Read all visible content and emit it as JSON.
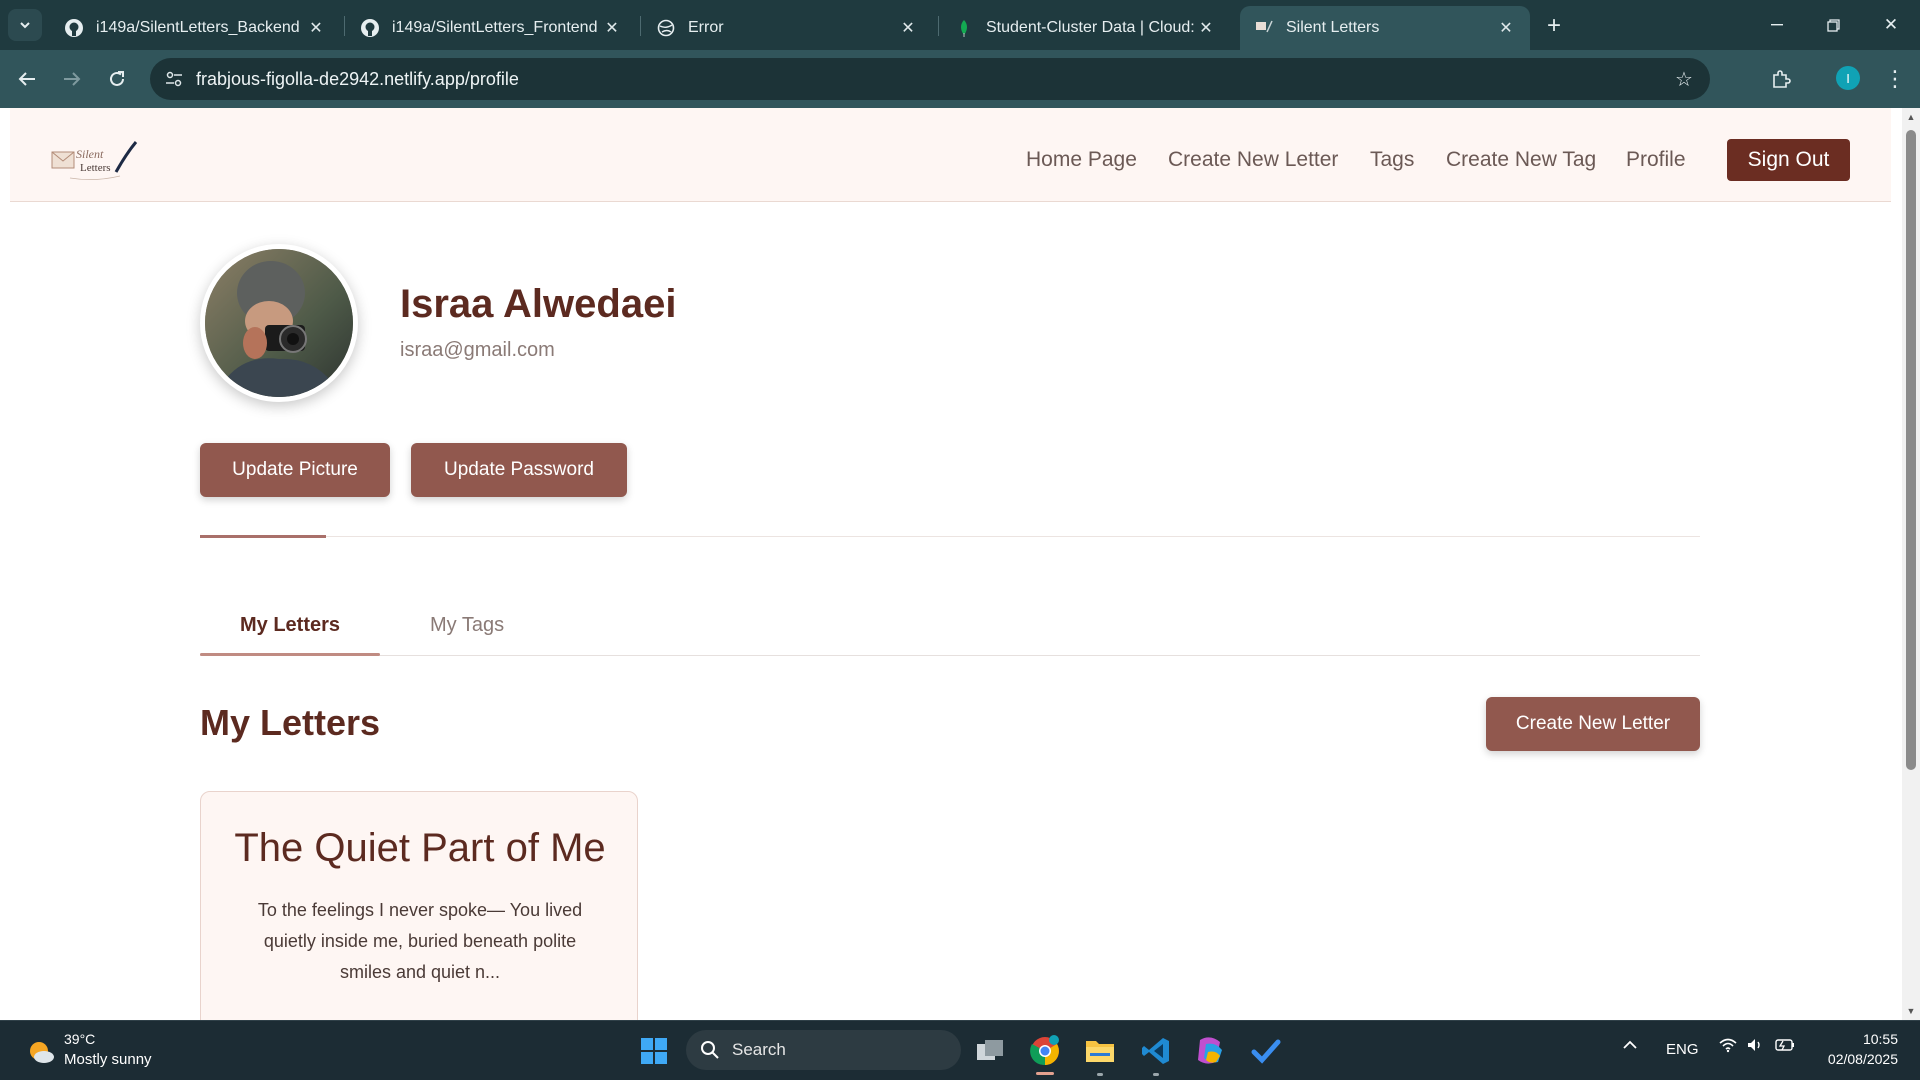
{
  "browser": {
    "tabs": [
      {
        "title": "i149a/SilentLetters_Backend",
        "icon": "github-icon"
      },
      {
        "title": "i149a/SilentLetters_Frontend",
        "icon": "github-icon"
      },
      {
        "title": "Error",
        "icon": "globe-icon"
      },
      {
        "title": "Student-Cluster Data | Cloud: M",
        "icon": "mongodb-leaf-icon"
      },
      {
        "title": "Silent Letters",
        "icon": "site-favicon-icon",
        "active": true
      }
    ],
    "url": "frabjous-figolla-de2942.netlify.app/profile",
    "profile_initial": "I"
  },
  "site": {
    "logo_text_line1": "Silent",
    "logo_text_line2": "Letters",
    "nav": {
      "home": "Home Page",
      "create_letter": "Create New Letter",
      "tags": "Tags",
      "create_tag": "Create New Tag",
      "profile": "Profile",
      "sign_out": "Sign Out"
    }
  },
  "profile": {
    "name": "Israa Alwedaei",
    "email": "israa@gmail.com",
    "update_picture": "Update Picture",
    "update_password": "Update Password"
  },
  "tabs": {
    "my_letters": "My Letters",
    "my_tags": "My Tags"
  },
  "section": {
    "title": "My Letters",
    "create_button": "Create New Letter"
  },
  "letters": [
    {
      "title": "The Quiet Part of Me",
      "excerpt": "To the feelings I never spoke— You lived quietly inside me, buried beneath polite smiles and quiet n..."
    }
  ],
  "taskbar": {
    "weather_temp": "39°C",
    "weather_desc": "Mostly sunny",
    "search_label": "Search",
    "language": "ENG",
    "time": "10:55",
    "date": "02/08/2025",
    "chrome_badge": "I"
  },
  "colors": {
    "brand_dark": "#6b2d22",
    "brand_button": "#91584e",
    "heading": "#5c2a20",
    "header_bg": "#fef6f3",
    "browser_frame": "#1f3a3f"
  }
}
